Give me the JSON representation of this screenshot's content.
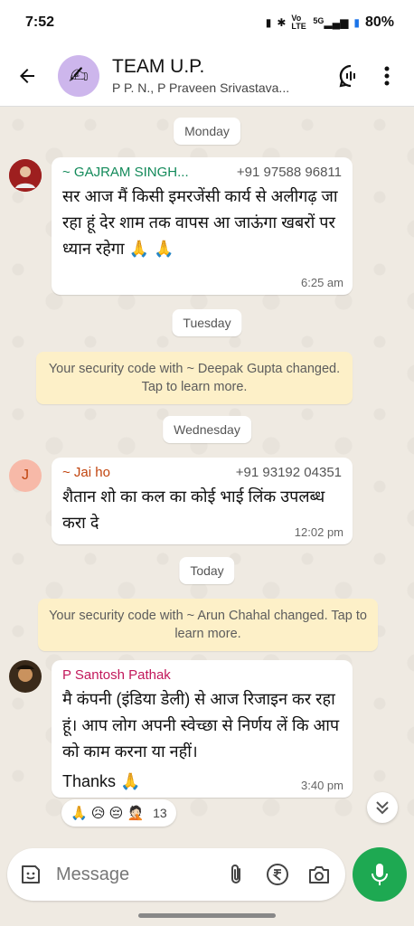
{
  "status_bar": {
    "time": "7:52",
    "network": "Vo LTE",
    "signal": "5G",
    "battery": "80%"
  },
  "header": {
    "title": "TEAM U.P.",
    "subtitle": "P P. N., P Praveen Srivastava...",
    "avatar_emoji": "✍"
  },
  "chat": {
    "day1": "Monday",
    "msg1": {
      "sender": "~ GAJRAM SINGH...",
      "phone": "+91 97588 96811",
      "text": "सर आज मैं किसी इमरजेंसी कार्य से अलीगढ़ जा रहा हूं देर शाम तक वापस आ जाऊंगा खबरों पर ध्यान रहेगा 🙏 🙏",
      "time": "6:25 am",
      "sender_color": "#138a5a"
    },
    "day2": "Tuesday",
    "sys1": "Your security code with ~ Deepak Gupta changed. Tap to learn more.",
    "day3": "Wednesday",
    "msg2": {
      "avatar_letter": "J",
      "sender": "~ Jai ho",
      "phone": "+91 93192 04351",
      "text": "शैतान शो का कल का कोई भाई लिंक उपलब्ध करा दे",
      "time": "12:02 pm",
      "sender_color": "#c1440e"
    },
    "day4": "Today",
    "sys2": "Your security code with ~ Arun Chahal changed. Tap to learn more.",
    "msg3": {
      "sender": "P Santosh Pathak",
      "text": "मै कंपनी (इंडिया डेली) से आज रिजाइन कर रहा हूं। आप लोग अपनी स्वेच्छा से निर्णय लें कि आप को काम करना या नहीं।",
      "text2": "Thanks 🙏",
      "time": "3:40 pm",
      "sender_color": "#c2185b"
    },
    "reactions": {
      "emojis": "🙏 😥 😔 🤦🏻",
      "count": "13"
    }
  },
  "composer": {
    "placeholder": "Message"
  },
  "colors": {
    "accent": "#1ea952",
    "system_bg": "#fdf0c8",
    "chat_bg": "#efeae2"
  }
}
